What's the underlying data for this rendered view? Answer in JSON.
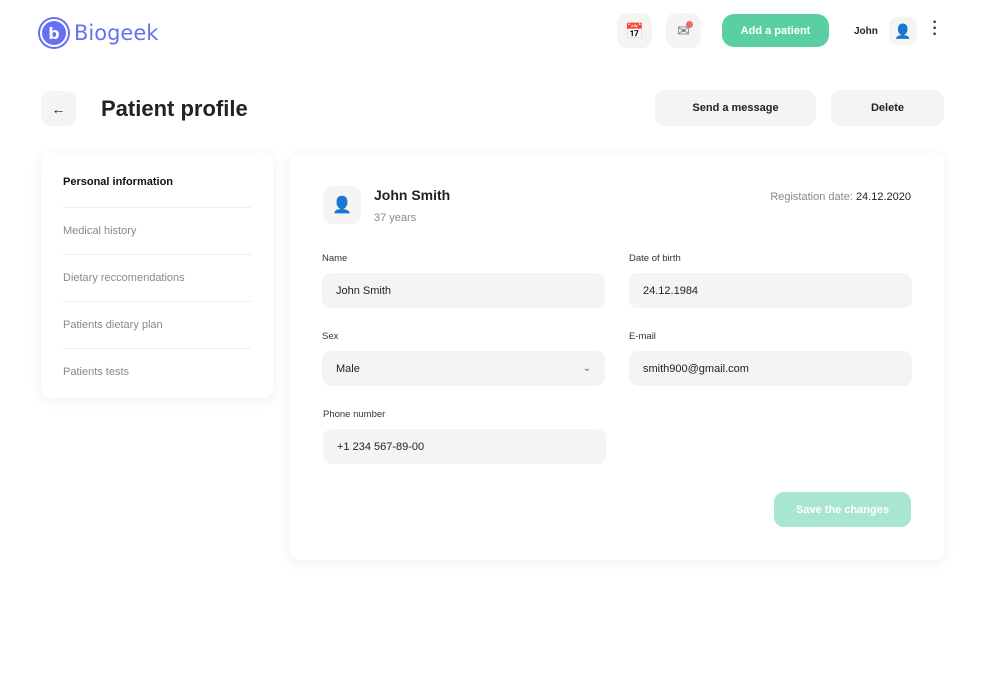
{
  "header": {
    "logo": "Biogeek",
    "add_patient": "Add a patient",
    "user_name": "John"
  },
  "page": {
    "title": "Patient profile",
    "send_message": "Send a message",
    "delete": "Delete"
  },
  "sidebar": {
    "items": [
      {
        "label": "Personal information"
      },
      {
        "label": "Medical history"
      },
      {
        "label": "Dietary reccomendations"
      },
      {
        "label": "Patients dietary plan"
      },
      {
        "label": "Patients tests"
      }
    ]
  },
  "profile": {
    "name": "John Smith",
    "age": "37 years",
    "registration_label": "Registation date:",
    "registration_date": "24.12.2020"
  },
  "form": {
    "name_label": "Name",
    "name_value": "John Smith",
    "dob_label": "Date of birth",
    "dob_value": "24.12.1984",
    "sex_label": "Sex",
    "sex_value": "Male",
    "email_label": "E-mail",
    "email_value": "smith900@gmail.com",
    "phone_label": "Phone number",
    "phone_value": "+1 234 567-89-00",
    "save": "Save the changes"
  },
  "colors": {
    "brand": "#6571f2",
    "accent": "#5bcfa4",
    "notification": "#f06a6a"
  }
}
